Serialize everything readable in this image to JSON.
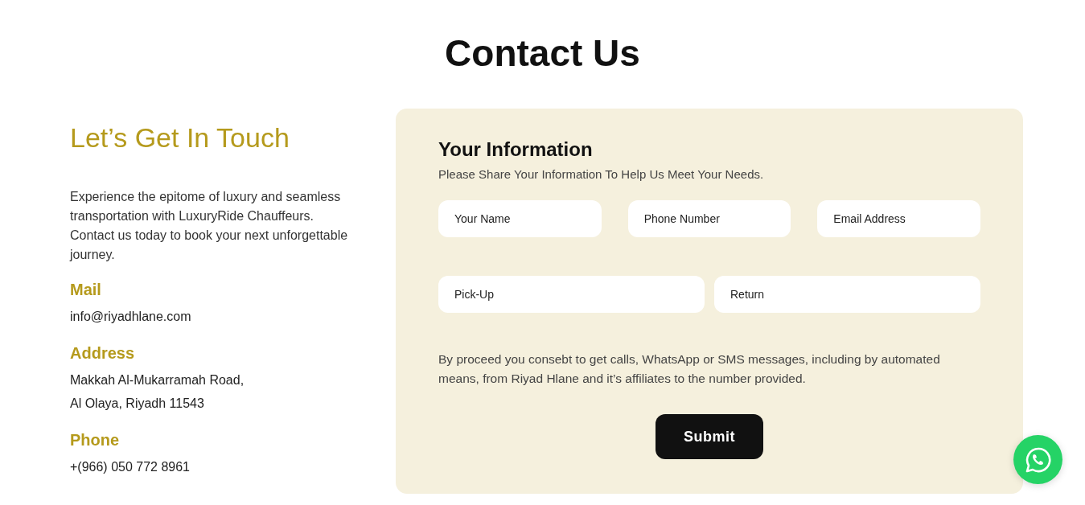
{
  "title": "Contact Us",
  "intro": {
    "heading": "Let’s Get In Touch",
    "text": "Experience the epitome of luxury and seamless transportation with LuxuryRide Chauffeurs. Contact us today to book your next unforgettable journey.",
    "details": [
      {
        "label": "Mail",
        "lines": [
          "info@riyadhlane.com"
        ]
      },
      {
        "label": "Address",
        "lines": [
          "Makkah Al-Mukarramah Road,",
          "Al Olaya, Riyadh 11543"
        ]
      },
      {
        "label": "Phone",
        "lines": [
          "+(966) 050 772 8961"
        ]
      }
    ]
  },
  "form": {
    "heading": "Your Information",
    "subheading": "Please Share Your Information To Help Us Meet Your Needs.",
    "rows": [
      [
        {
          "placeholder": "Your Name"
        },
        {
          "placeholder": "Phone Number"
        },
        {
          "placeholder": "Email Address"
        }
      ],
      [
        {
          "placeholder": "Pick-Up"
        },
        {
          "placeholder": "Return"
        }
      ]
    ],
    "consent": "By proceed you consebt to get calls, WhatsApp or SMS messages, including by automated means, from Riyad Hlane and it’s affiliates to the number provided.",
    "submit": "Submit"
  }
}
